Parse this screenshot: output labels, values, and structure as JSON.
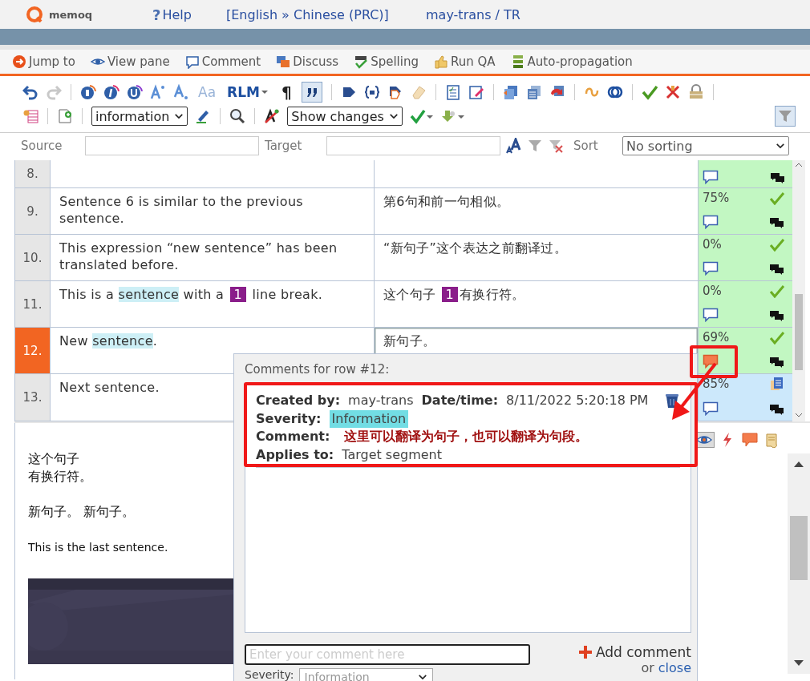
{
  "header": {
    "logo": "memoq",
    "help_icon": "?",
    "help": "Help",
    "language_pair": "[English » Chinese (PRC)]",
    "user": "may-trans / TR"
  },
  "actions": [
    {
      "kind": "jump",
      "label": "Jump to"
    },
    {
      "kind": "view",
      "label": "View pane"
    },
    {
      "kind": "comment",
      "label": "Comment"
    },
    {
      "kind": "discuss",
      "label": "Discuss"
    },
    {
      "kind": "spelling",
      "label": "Spelling"
    },
    {
      "kind": "qa",
      "label": "Run QA"
    },
    {
      "kind": "propagation",
      "label": "Auto-propagation"
    }
  ],
  "toolbar": {
    "case_label": "Aa",
    "rlm_label": "RLM",
    "pilcrow": "¶",
    "quote_pressed": true,
    "format_filter": "information",
    "changes_view": "Show changes",
    "filter_pressed": true
  },
  "filter_bar": {
    "source_label": "Source",
    "target_label": "Target",
    "sort_label": "Sort",
    "sort_value": "No sorting"
  },
  "rows": [
    {
      "number": "8.",
      "selected": false,
      "kind": "confirmed",
      "commented": false,
      "source": [],
      "target": []
    },
    {
      "number": "9.",
      "selected": false,
      "kind": "confirmed",
      "commented": false,
      "match": "75%",
      "source": [
        {
          "kind": "plain",
          "text": "Sentence 6 is similar to the previous sentence."
        }
      ],
      "target": [
        {
          "kind": "plain",
          "text": "第6句和前一句相似。"
        }
      ]
    },
    {
      "number": "10.",
      "selected": false,
      "kind": "confirmed",
      "commented": false,
      "match": "0%",
      "source": [
        {
          "kind": "plain",
          "text": "This expression “new sentence” has been translated before."
        }
      ],
      "target": [
        {
          "kind": "plain",
          "text": "“新句子”这个表达之前翻译过。"
        }
      ]
    },
    {
      "number": "11.",
      "selected": false,
      "kind": "confirmed",
      "commented": false,
      "match": "0%",
      "source": [
        {
          "kind": "plain",
          "text": "This is a "
        },
        {
          "kind": "term",
          "text": "sentence"
        },
        {
          "kind": "plain",
          "text": " with a "
        },
        {
          "kind": "tag",
          "text": "1"
        },
        {
          "kind": "plain",
          "text": " line break."
        }
      ],
      "target": [
        {
          "kind": "plain",
          "text": "这个句子 "
        },
        {
          "kind": "tag",
          "text": "1"
        },
        {
          "kind": "plain",
          "text": "有换行符。"
        }
      ]
    },
    {
      "number": "12.",
      "selected": true,
      "kind": "confirmed",
      "commented": true,
      "match": "69%",
      "source": [
        {
          "kind": "plain",
          "text": "New "
        },
        {
          "kind": "term",
          "text": "sentence"
        },
        {
          "kind": "plain",
          "text": "."
        }
      ],
      "target": [
        {
          "kind": "plain",
          "text": "新句子。"
        }
      ]
    },
    {
      "number": "13.",
      "selected": false,
      "kind": "pretranslated",
      "commented": false,
      "match": "85%",
      "source": [
        {
          "kind": "plain",
          "text": "Next sentence."
        }
      ],
      "target": []
    }
  ],
  "preview": {
    "paragraphs": [
      {
        "kind": "cjk",
        "lines": [
          "这个句子",
          "有换行符。"
        ]
      },
      {
        "kind": "cjk",
        "lines": [
          "新句子。 新句子。"
        ]
      },
      {
        "kind": "latin",
        "lines": [
          "This is the last sentence."
        ]
      }
    ]
  },
  "side_panel": {
    "view_pressed": true
  },
  "comments_popup": {
    "title": "Comments for row #12:",
    "comments": [
      {
        "created_by_label": "Created by:",
        "created_by": "may-trans",
        "date_label": "Date/time:",
        "date": "8/11/2022 5:20:18 PM",
        "severity_label": "Severity:",
        "severity": "Information",
        "comment_label": "Comment:",
        "comment": "这里可以翻译为句子，也可以翻译为句段。",
        "applies_label": "Applies to:",
        "applies": "Target segment"
      }
    ],
    "placeholder": "Enter your comment here",
    "add": "Add comment",
    "or": "or",
    "close": "close",
    "severity_label": "Severity:",
    "severity_value": "Information"
  }
}
